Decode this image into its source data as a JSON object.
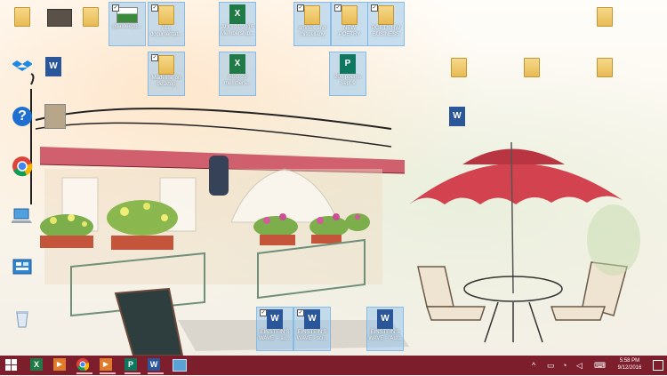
{
  "desktop": {
    "icons": [
      {
        "key": "folder1",
        "type": "folder",
        "caption": ""
      },
      {
        "key": "video",
        "type": "video",
        "caption": ""
      },
      {
        "key": "folder2",
        "type": "folder",
        "caption": ""
      },
      {
        "key": "img",
        "type": "image",
        "caption": "goaldeepb..."
      },
      {
        "key": "all_docs",
        "type": "folder",
        "caption": "ALL documentat..."
      },
      {
        "key": "xls_sep",
        "type": "excel",
        "caption": "AUG 31 2016 Membership..."
      },
      {
        "key": "articles",
        "type": "folder",
        "caption": "articles and miscellany"
      },
      {
        "key": "newpoetry",
        "type": "folder",
        "caption": "NEW POETRY"
      },
      {
        "key": "poets",
        "type": "folder",
        "caption": "POETS HW BUSINESS"
      },
      {
        "key": "folder_r1",
        "type": "folder",
        "caption": ""
      },
      {
        "key": "dropbox",
        "type": "app",
        "caption": ""
      },
      {
        "key": "word_l",
        "type": "word",
        "caption": ""
      },
      {
        "key": "madeline",
        "type": "folder",
        "caption": "Madeline on desktop"
      },
      {
        "key": "xls_aug",
        "type": "excel",
        "caption": "AUG 29 members..."
      },
      {
        "key": "pub",
        "type": "publisher",
        "caption": "200 poems Sept 9"
      },
      {
        "key": "folder_r2",
        "type": "folder",
        "caption": ""
      },
      {
        "key": "folder_r3",
        "type": "folder",
        "caption": ""
      },
      {
        "key": "folder_r4",
        "type": "folder",
        "caption": ""
      },
      {
        "key": "help",
        "type": "app",
        "caption": ""
      },
      {
        "key": "thumb",
        "type": "image",
        "caption": ""
      },
      {
        "key": "word_mid",
        "type": "word",
        "caption": ""
      },
      {
        "key": "chrome",
        "type": "app",
        "caption": ""
      },
      {
        "key": "thispc",
        "type": "app",
        "caption": ""
      },
      {
        "key": "cpanel",
        "type": "app",
        "caption": ""
      },
      {
        "key": "recycle",
        "type": "app",
        "caption": ""
      },
      {
        "key": "word_b1",
        "type": "word",
        "caption": "EINSTEIN'S WAVE -- au..."
      },
      {
        "key": "word_b2",
        "type": "word",
        "caption": "EINSTEIN'S WAVE - sci..."
      },
      {
        "key": "word_b3",
        "type": "word",
        "caption": "EINSTEIN'S WAVE -- AU..."
      }
    ]
  },
  "taskbar": {
    "start_icon": "windows-logo-icon",
    "apps": [
      {
        "name": "excel-taskbar-icon",
        "color": "#1f7a46",
        "label": "X"
      },
      {
        "name": "media-taskbar-icon",
        "color": "#e07b2b",
        "label": "▶"
      },
      {
        "name": "chrome-taskbar-icon",
        "color": "#db4437",
        "label": ""
      },
      {
        "name": "media2-taskbar-icon",
        "color": "#e07b2b",
        "label": "▶"
      },
      {
        "name": "publisher-taskbar-icon",
        "color": "#0f7660",
        "label": "P"
      },
      {
        "name": "word-taskbar-icon",
        "color": "#2b579a",
        "label": "W"
      },
      {
        "name": "explorer-taskbar-icon",
        "color": "#5aa1d6",
        "label": ""
      }
    ],
    "time": "5:58 PM",
    "date": "9/12/2016"
  }
}
